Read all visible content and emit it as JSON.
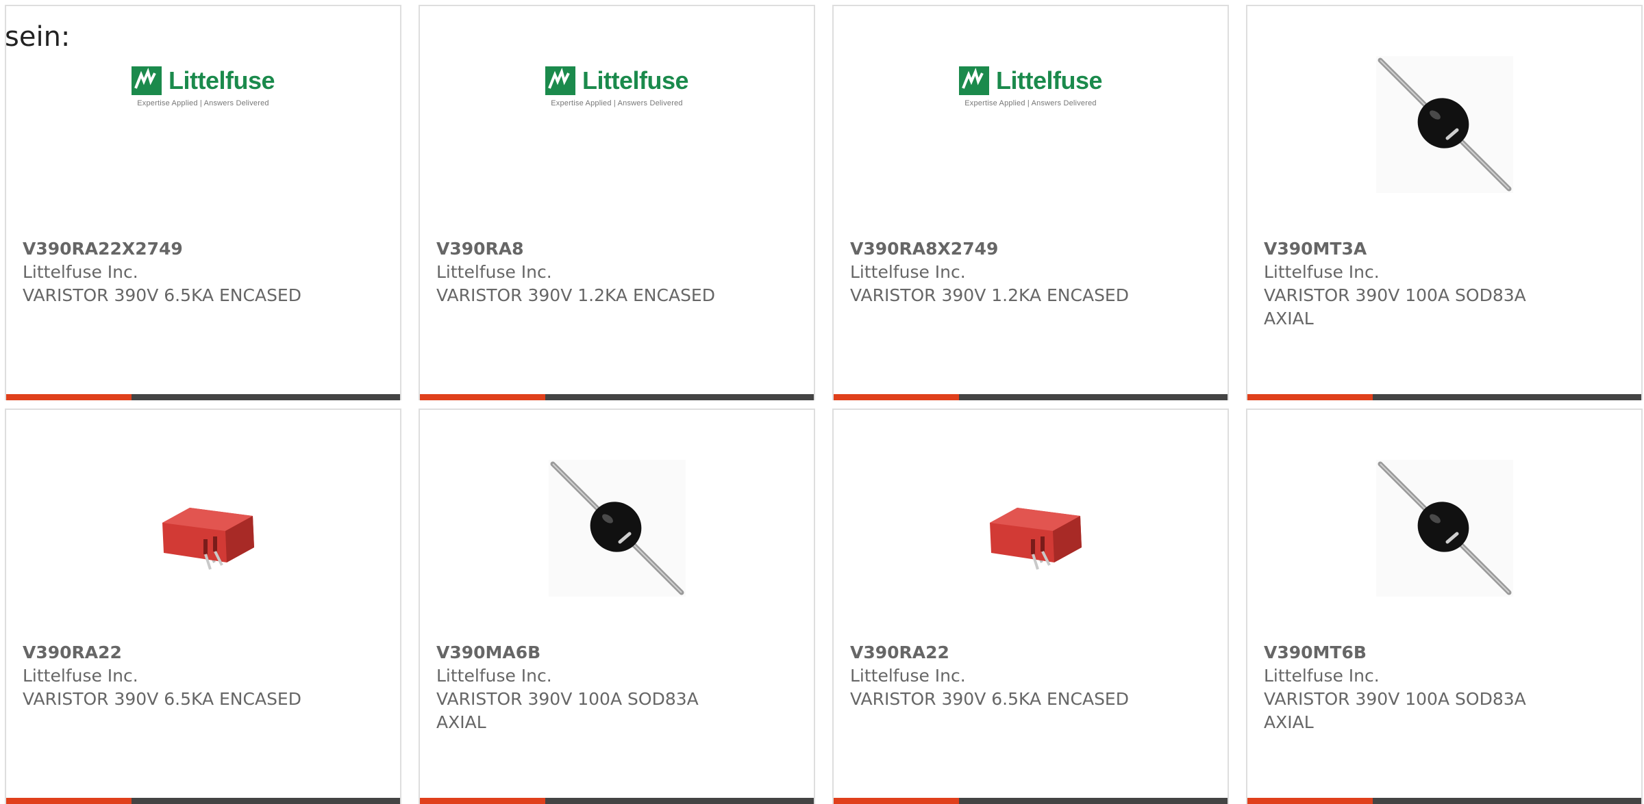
{
  "intro_text": "sein:",
  "colors": {
    "accent": "#e0401c",
    "bar": "#444444",
    "text": "#666666",
    "logo_green": "#1b8a4c",
    "varistor_red": "#d23a35"
  },
  "logo": {
    "wordmark": "Littelfuse",
    "tagline": "Expertise Applied | Answers Delivered"
  },
  "products": [
    {
      "part_number": "V390RA22X2749",
      "manufacturer": "Littelfuse Inc.",
      "description": "VARISTOR 390V 6.5KA ENCASED",
      "image": "littelfuse-logo"
    },
    {
      "part_number": "V390RA8",
      "manufacturer": "Littelfuse Inc.",
      "description": "VARISTOR 390V 1.2KA ENCASED",
      "image": "littelfuse-logo"
    },
    {
      "part_number": "V390RA8X2749",
      "manufacturer": "Littelfuse Inc.",
      "description": "VARISTOR 390V 1.2KA ENCASED",
      "image": "littelfuse-logo"
    },
    {
      "part_number": "V390MT3A",
      "manufacturer": "Littelfuse Inc.",
      "description": "VARISTOR 390V 100A SOD83A AXIAL",
      "image": "axial-varistor-photo"
    },
    {
      "part_number": "V390RA22",
      "manufacturer": "Littelfuse Inc.",
      "description": "VARISTOR 390V 6.5KA ENCASED",
      "image": "encased-varistor-photo"
    },
    {
      "part_number": "V390MA6B",
      "manufacturer": "Littelfuse Inc.",
      "description": "VARISTOR 390V 100A SOD83A AXIAL",
      "image": "axial-varistor-photo"
    },
    {
      "part_number": "V390RA22",
      "manufacturer": "Littelfuse Inc.",
      "description": "VARISTOR 390V 6.5KA ENCASED",
      "image": "encased-varistor-photo"
    },
    {
      "part_number": "V390MT6B",
      "manufacturer": "Littelfuse Inc.",
      "description": "VARISTOR 390V 100A SOD83A AXIAL",
      "image": "axial-varistor-photo"
    }
  ]
}
